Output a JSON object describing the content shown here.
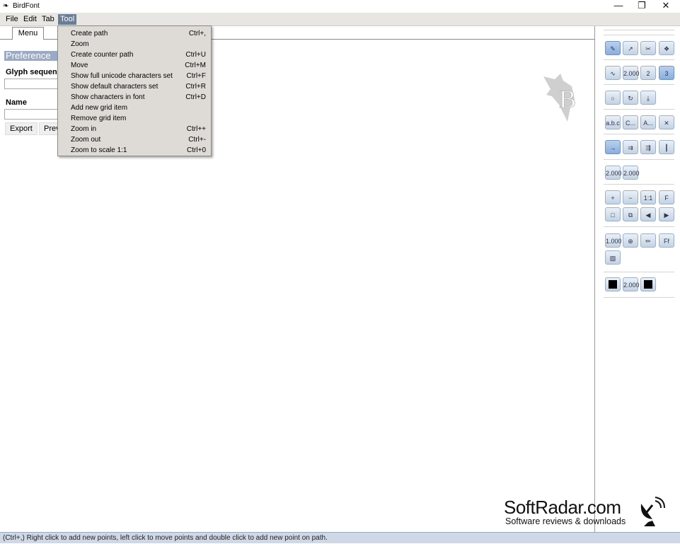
{
  "window": {
    "title": "BirdFont"
  },
  "menubar": {
    "items": [
      "File",
      "Edit",
      "Tab",
      "Tool"
    ],
    "active": "Tool"
  },
  "tab": {
    "label": "Menu"
  },
  "dropdown": {
    "items": [
      {
        "label": "Create path",
        "shortcut": "Ctrl+,"
      },
      {
        "label": "Zoom",
        "shortcut": ""
      },
      {
        "label": "Create counter path",
        "shortcut": "Ctrl+U"
      },
      {
        "label": "Move",
        "shortcut": "Ctrl+M"
      },
      {
        "label": "Show full unicode characters set",
        "shortcut": "Ctrl+F"
      },
      {
        "label": "Show default characters set",
        "shortcut": "Ctrl+R"
      },
      {
        "label": "Show characters in font",
        "shortcut": "Ctrl+D"
      },
      {
        "label": "Add new grid item",
        "shortcut": ""
      },
      {
        "label": "Remove grid item",
        "shortcut": ""
      },
      {
        "label": "Zoom in",
        "shortcut": "Ctrl++"
      },
      {
        "label": "Zoom out",
        "shortcut": "Ctrl+-"
      },
      {
        "label": "Zoom to scale 1:1",
        "shortcut": "Ctrl+0"
      }
    ]
  },
  "preferences": {
    "title": "Preference",
    "glyph_label": "Glyph sequen",
    "name_label": "Name",
    "export_label": "Export",
    "preview_label": "Prev"
  },
  "toolbox": {
    "row1": [
      "pen-tool",
      "pointer-tool",
      "eraser-tool",
      "node-tool"
    ],
    "row2_values": [
      "2.000",
      "2",
      "3"
    ],
    "row6_values": [
      "2.000",
      "2.000"
    ],
    "zoom_buttons": [
      "+",
      "−",
      "1:1",
      "F"
    ],
    "row8_values": [
      "1.000"
    ],
    "row9_values": [
      "2.000"
    ],
    "row4_labels": [
      "a.b.c",
      "C...",
      "A..."
    ]
  },
  "status": {
    "text": "(Ctrl+,) Right click to add new points, left click to move points and double click to add new point on path."
  },
  "watermark": {
    "brand": "SoftRadar.com",
    "tagline": "Software reviews & downloads"
  }
}
